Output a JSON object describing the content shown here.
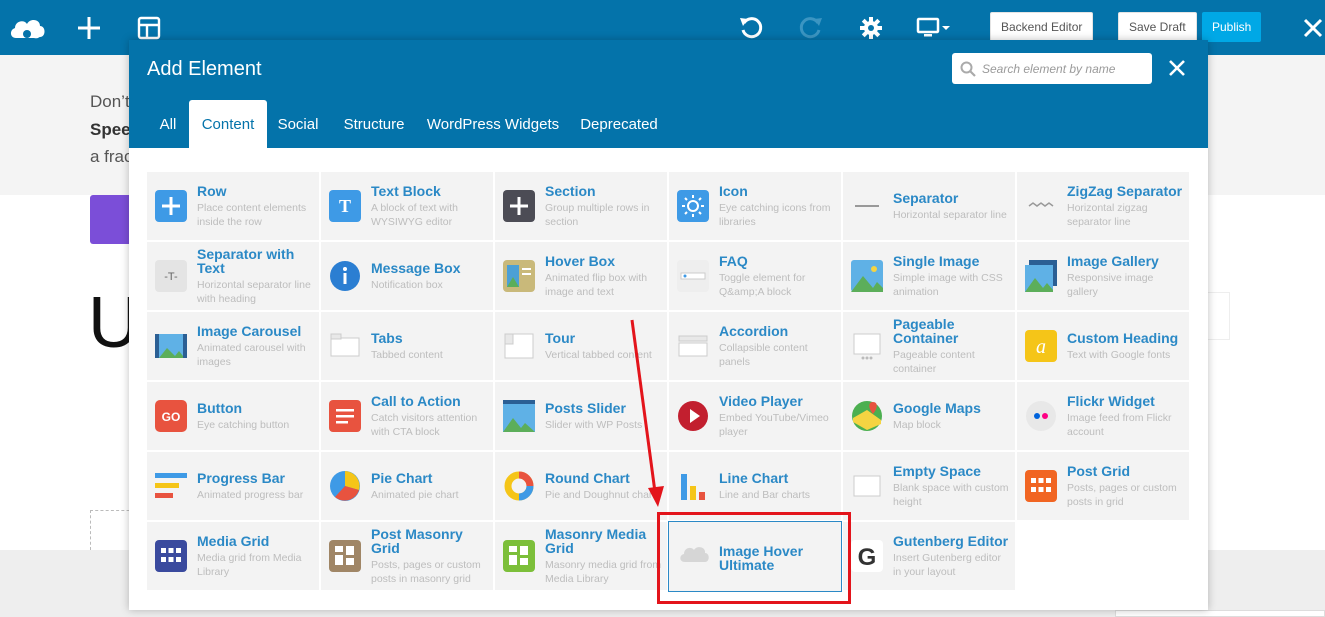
{
  "topbar": {
    "backend_editor": "Backend Editor",
    "save_draft": "Save Draft",
    "publish": "Publish"
  },
  "background": {
    "line1": "Don’t",
    "line2": "Spee",
    "line3": "a frac",
    "big_letter": "U"
  },
  "modal": {
    "title": "Add Element",
    "search_placeholder": "Search element by name",
    "tabs": [
      "All",
      "Content",
      "Social",
      "Structure",
      "WordPress Widgets",
      "Deprecated"
    ],
    "active_tab": "Content"
  },
  "elements": [
    {
      "name": "Row",
      "desc": "Place content elements inside the row",
      "icon": "plus-square"
    },
    {
      "name": "Text Block",
      "desc": "A block of text with WYSIWYG editor",
      "icon": "text-t"
    },
    {
      "name": "Section",
      "desc": "Group multiple rows in section",
      "icon": "plus-dark"
    },
    {
      "name": "Icon",
      "desc": "Eye catching icons from libraries",
      "icon": "sun"
    },
    {
      "name": "Separator",
      "desc": "Horizontal separator line",
      "icon": "separator-line"
    },
    {
      "name": "ZigZag Separator",
      "desc": "Horizontal zigzag separator line",
      "icon": "zigzag"
    },
    {
      "name": "Separator with Text",
      "desc": "Horizontal separator line with heading",
      "icon": "separator-text"
    },
    {
      "name": "Message Box",
      "desc": "Notification box",
      "icon": "info-circle"
    },
    {
      "name": "Hover Box",
      "desc": "Animated flip box with image and text",
      "icon": "hover-box"
    },
    {
      "name": "FAQ",
      "desc": "Toggle element for Q&amp;A block",
      "icon": "faq"
    },
    {
      "name": "Single Image",
      "desc": "Simple image with CSS animation",
      "icon": "image"
    },
    {
      "name": "Image Gallery",
      "desc": "Responsive image gallery",
      "icon": "gallery"
    },
    {
      "name": "Image Carousel",
      "desc": "Animated carousel with images",
      "icon": "carousel"
    },
    {
      "name": "Tabs",
      "desc": "Tabbed content",
      "icon": "tabs"
    },
    {
      "name": "Tour",
      "desc": "Vertical tabbed content",
      "icon": "tour"
    },
    {
      "name": "Accordion",
      "desc": "Collapsible content panels",
      "icon": "accordion"
    },
    {
      "name": "Pageable Container",
      "desc": "Pageable content container",
      "icon": "pageable"
    },
    {
      "name": "Custom Heading",
      "desc": "Text with Google fonts",
      "icon": "custom-heading"
    },
    {
      "name": "Button",
      "desc": "Eye catching button",
      "icon": "go-button"
    },
    {
      "name": "Call to Action",
      "desc": "Catch visitors attention with CTA block",
      "icon": "cta"
    },
    {
      "name": "Posts Slider",
      "desc": "Slider with WP Posts",
      "icon": "posts-slider"
    },
    {
      "name": "Video Player",
      "desc": "Embed YouTube/Vimeo player",
      "icon": "play"
    },
    {
      "name": "Google Maps",
      "desc": "Map block",
      "icon": "map"
    },
    {
      "name": "Flickr Widget",
      "desc": "Image feed from Flickr account",
      "icon": "flickr"
    },
    {
      "name": "Progress Bar",
      "desc": "Animated progress bar",
      "icon": "progress"
    },
    {
      "name": "Pie Chart",
      "desc": "Animated pie chart",
      "icon": "pie"
    },
    {
      "name": "Round Chart",
      "desc": "Pie and Doughnut charts",
      "icon": "donut"
    },
    {
      "name": "Line Chart",
      "desc": "Line and Bar charts",
      "icon": "bars"
    },
    {
      "name": "Empty Space",
      "desc": "Blank space with custom height",
      "icon": "empty-space"
    },
    {
      "name": "Post Grid",
      "desc": "Posts, pages or custom posts in grid",
      "icon": "post-grid"
    },
    {
      "name": "Media Grid",
      "desc": "Media grid from Media Library",
      "icon": "media-grid"
    },
    {
      "name": "Post Masonry Grid",
      "desc": "Posts, pages or custom posts in masonry grid",
      "icon": "post-masonry"
    },
    {
      "name": "Masonry Media Grid",
      "desc": "Masonry media grid from Media Library",
      "icon": "masonry-media"
    },
    {
      "name": "Image Hover Ultimate",
      "desc": "",
      "icon": "cloud"
    },
    {
      "name": "Gutenberg Editor",
      "desc": "Insert Gutenberg editor in your layout",
      "icon": "gutenberg"
    }
  ],
  "colors": {
    "brand": "#0473aa",
    "element_name": "#2b89c6",
    "highlight": "#e3141b"
  }
}
